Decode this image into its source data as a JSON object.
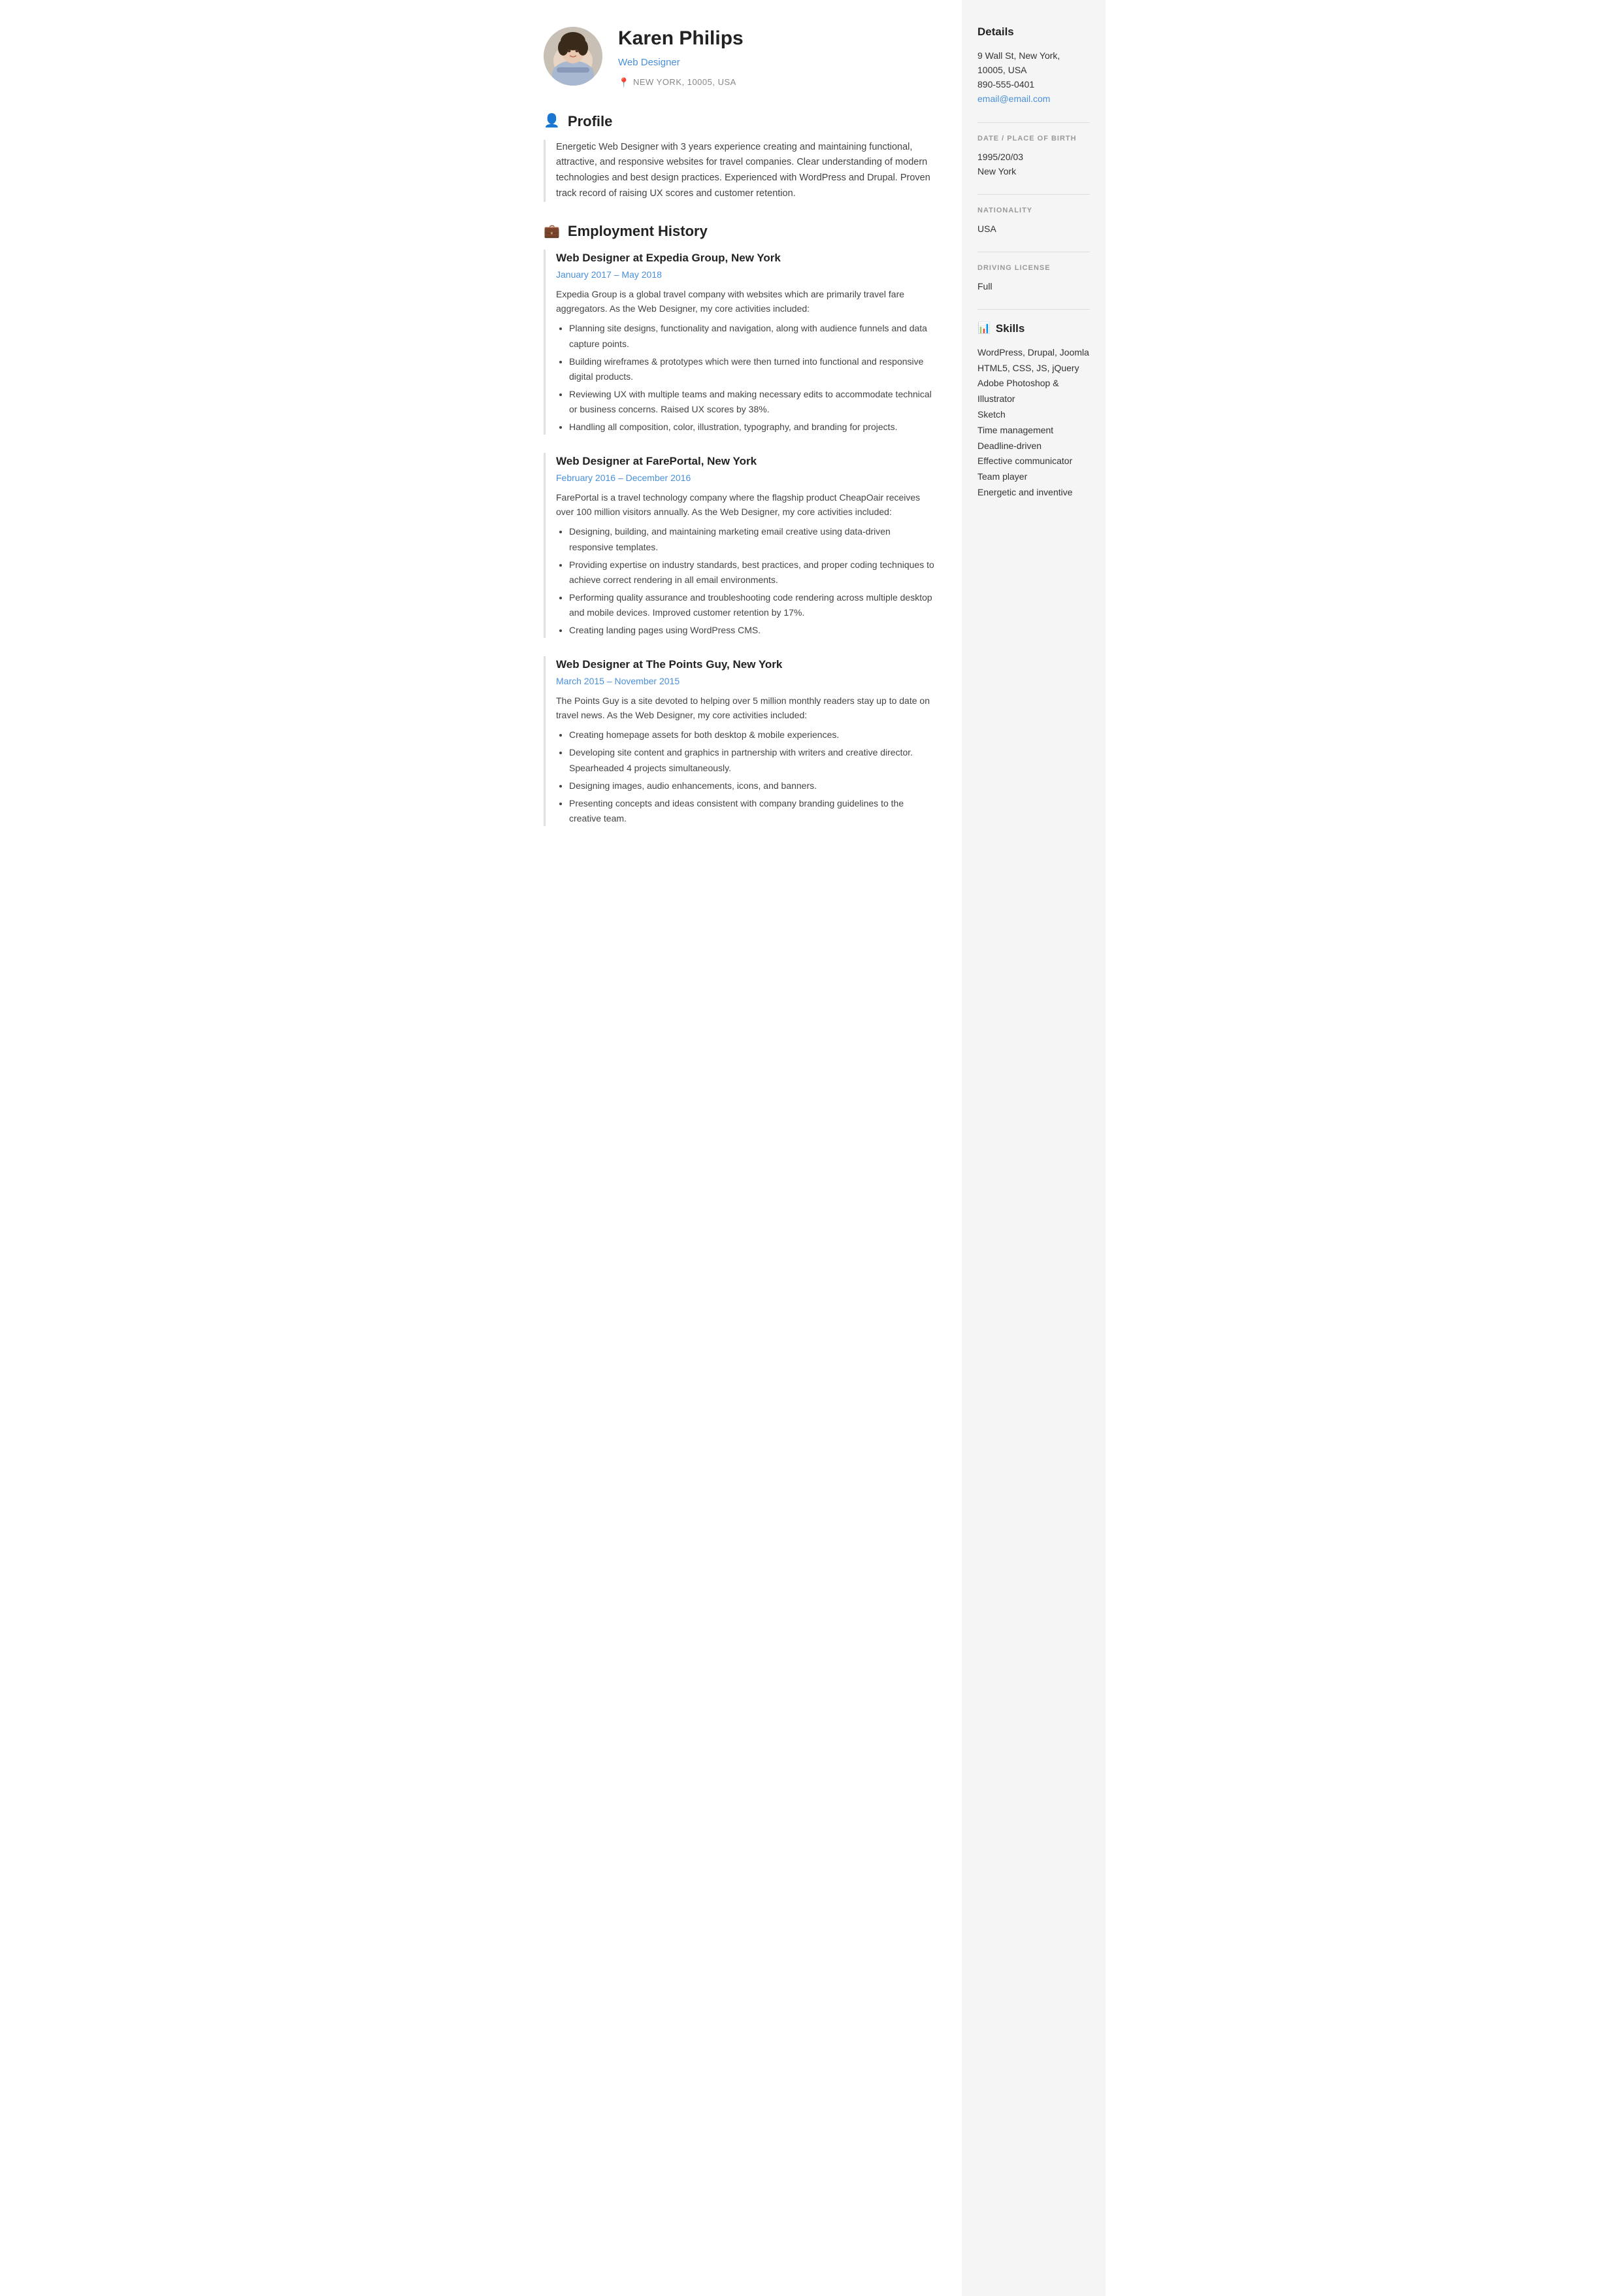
{
  "header": {
    "name": "Karen Philips",
    "job_title": "Web Designer",
    "location": "NEW YORK, 10005, USA"
  },
  "sidebar": {
    "details_title": "Details",
    "address": "9 Wall St, New York, 10005, USA",
    "phone": "890-555-0401",
    "email": "email@email.com",
    "birth_label": "DATE / PLACE OF BIRTH",
    "birth_date": "1995/20/03",
    "birth_place": "New York",
    "nationality_label": "NATIONALITY",
    "nationality": "USA",
    "license_label": "DRIVING LICENSE",
    "license": "Full",
    "skills_title": "Skills",
    "skills": [
      "WordPress, Drupal, Joomla",
      "HTML5, CSS, JS, jQuery",
      "Adobe Photoshop & Illustrator",
      "Sketch",
      "Time management",
      "Deadline-driven",
      "Effective communicator",
      "Team player",
      "Energetic and inventive"
    ]
  },
  "profile": {
    "section_title": "Profile",
    "text": "Energetic Web Designer with 3 years experience creating and maintaining functional, attractive, and responsive websites for travel companies. Clear understanding of modern technologies and best design practices. Experienced with WordPress and Drupal. Proven track record of raising UX scores and customer retention."
  },
  "employment": {
    "section_title": "Employment History",
    "jobs": [
      {
        "title": "Web Designer at Expedia Group, New York",
        "dates": "January 2017  –  May 2018",
        "description": "Expedia Group is a global travel company with websites which are primarily travel fare aggregators. As the Web Designer, my core activities included:",
        "bullets": [
          "Planning site designs, functionality and navigation, along with audience funnels and data capture points.",
          "Building wireframes & prototypes which were then turned into functional and responsive digital products.",
          "Reviewing UX with multiple teams and making necessary edits to accommodate technical or business concerns. Raised UX scores by 38%.",
          "Handling all composition, color, illustration, typography, and branding for projects."
        ]
      },
      {
        "title": "Web Designer at FarePortal, New York",
        "dates": "February 2016  –  December 2016",
        "description": "FarePortal is a travel technology company where the flagship product CheapOair receives over 100 million visitors annually. As the Web Designer, my core activities included:",
        "bullets": [
          "Designing, building, and maintaining marketing email creative using data-driven responsive templates.",
          "Providing expertise on industry standards, best practices, and proper coding techniques to achieve correct rendering in all email environments.",
          "Performing quality assurance and troubleshooting code rendering across multiple desktop and mobile devices. Improved customer retention by 17%.",
          "Creating landing pages using WordPress CMS."
        ]
      },
      {
        "title": "Web Designer at The Points Guy, New York",
        "dates": "March 2015  –  November 2015",
        "description": "The Points Guy is a site devoted to helping over 5 million monthly readers stay up to date on travel news. As the Web Designer, my core activities included:",
        "bullets": [
          "Creating homepage assets for both desktop & mobile experiences.",
          "Developing site content and graphics in partnership with writers and creative director. Spearheaded 4 projects simultaneously.",
          "Designing images, audio enhancements, icons, and banners.",
          "Presenting concepts and ideas consistent with company branding guidelines to the creative team."
        ]
      }
    ]
  },
  "icons": {
    "profile_icon": "👤",
    "employment_icon": "💼",
    "location_icon": "📍",
    "skills_icon": "📊"
  }
}
